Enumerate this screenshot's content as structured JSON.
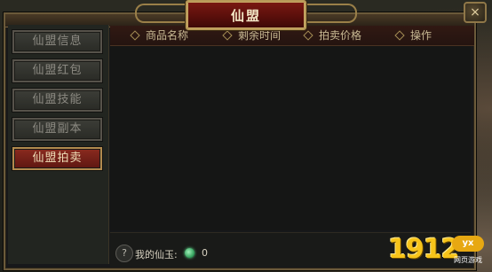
{
  "window": {
    "title": "仙盟",
    "close_glyph": "×"
  },
  "sidebar": {
    "items": [
      {
        "label": "仙盟信息",
        "active": false
      },
      {
        "label": "仙盟红包",
        "active": false
      },
      {
        "label": "仙盟技能",
        "active": false
      },
      {
        "label": "仙盟副本",
        "active": false
      },
      {
        "label": "仙盟拍卖",
        "active": true
      }
    ]
  },
  "table": {
    "columns": [
      "商品名称",
      "剩余时间",
      "拍卖价格",
      "操作"
    ],
    "rows": []
  },
  "footer": {
    "help_glyph": "?",
    "currency_label": "我的仙玉:",
    "currency_icon": "jade-icon",
    "currency_value": "0"
  },
  "watermark": {
    "number": "1912",
    "badge": "yx",
    "subtitle": "网页游戏"
  },
  "colors": {
    "active_tab": "#8a2a1f",
    "title_plaque": "#7b1912",
    "gold_border": "#b89a58",
    "watermark": "#f7c41a"
  }
}
